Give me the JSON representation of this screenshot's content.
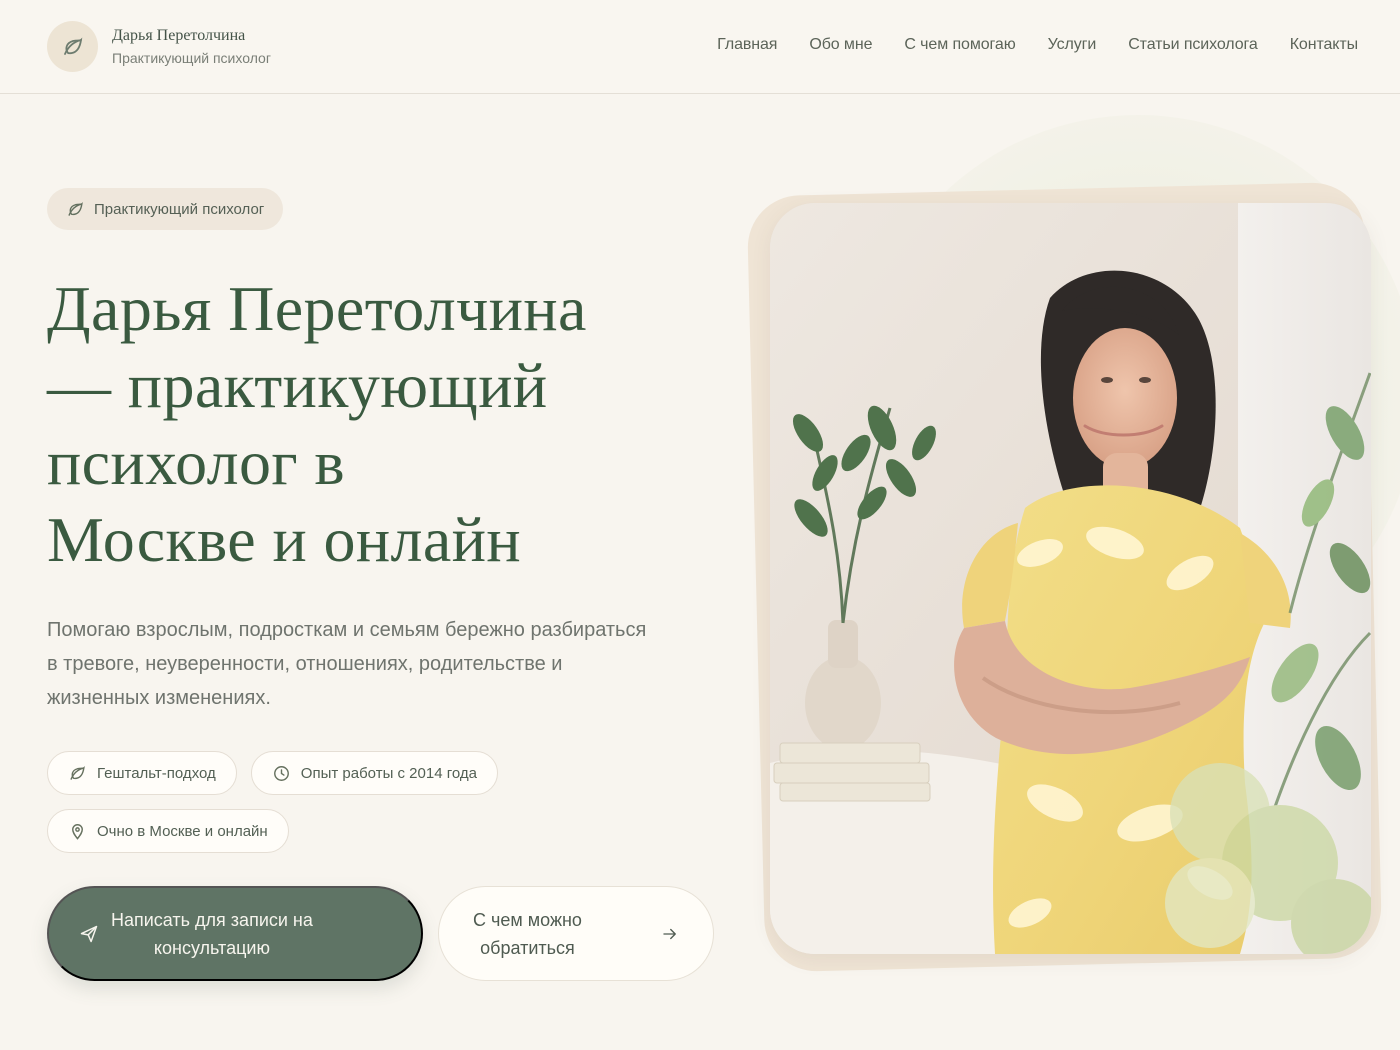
{
  "brand": {
    "name": "Дарья Перетолчина",
    "subtitle": "Практикующий психолог",
    "logo_icon": "leaf-icon"
  },
  "nav": {
    "items": [
      "Главная",
      "Обо мне",
      "С чем помогаю",
      "Услуги",
      "Статьи психолога",
      "Контакты"
    ]
  },
  "hero": {
    "badge": "Практикующий психолог",
    "title_lines": [
      "Дарья Перетолчина",
      "— практикующий",
      "психолог в",
      "Москве и онлайн"
    ],
    "description_lines": [
      "Помогаю взрослым, подросткам и семьям бережно разбираться",
      "в тревоге, неуверенности, отношениях, родительстве и",
      "жизненных изменениях."
    ],
    "tags": [
      {
        "label": "Гештальт-подход",
        "icon": "leaf-icon"
      },
      {
        "label": "Опыт работы с 2014 года",
        "icon": "clock-icon"
      },
      {
        "label": "Очно в Москве и онлайн",
        "icon": "location-pin-icon"
      }
    ],
    "primary_button_lines": [
      "Написать для записи на",
      "консультацию"
    ],
    "secondary_button_lines": [
      "С чем можно",
      "обратиться"
    ]
  },
  "colors": {
    "background": "#f8f5ef",
    "accent_green": "#5f7465",
    "title_green": "#3a5a40",
    "card_beige": "#efe4d5"
  },
  "image": {
    "alt": "Портрет психолога в жёлтом платье рядом с растениями"
  }
}
